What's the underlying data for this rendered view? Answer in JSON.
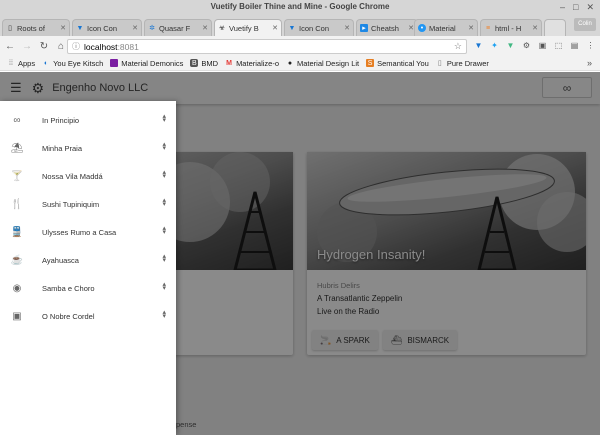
{
  "window": {
    "title": "Vuetify Boiler Thine and Mine - Google Chrome",
    "minimize": "–",
    "maximize": "□",
    "close": "✕"
  },
  "tabs": [
    {
      "label": "Roots of",
      "icon": "page-icon",
      "active": false
    },
    {
      "label": "Icon Con",
      "icon": "vuetify-icon",
      "active": false
    },
    {
      "label": "Quasar F",
      "icon": "quasar-icon",
      "active": false
    },
    {
      "label": "Vuetify B",
      "icon": "biohazard-icon",
      "active": true
    },
    {
      "label": "Icon Con",
      "icon": "vuetify-icon",
      "active": false
    },
    {
      "label": "Cheatsh",
      "icon": "cheatsheet-icon",
      "active": false
    },
    {
      "label": "Material",
      "icon": "material-icon",
      "active": false
    },
    {
      "label": "html - H",
      "icon": "stackoverflow-icon",
      "active": false
    }
  ],
  "profile_label": "Colin",
  "toolbar": {
    "url_host": "localhost",
    "url_port": ":8081"
  },
  "bookmarks": [
    {
      "label": "Apps",
      "icon": "apps-grid-icon"
    },
    {
      "label": "You Eye Kitsch",
      "icon": "vuetify-icon"
    },
    {
      "label": "Material Demonics",
      "icon": "material-icon"
    },
    {
      "label": "BMD",
      "icon": "b-icon"
    },
    {
      "label": "Materialize-o",
      "icon": "materialize-icon"
    },
    {
      "label": "Material Design Lit",
      "icon": "github-icon"
    },
    {
      "label": "Semantical You",
      "icon": "semantic-icon"
    },
    {
      "label": "Pure Drawer",
      "icon": "page-icon"
    }
  ],
  "app": {
    "title": "Engenho Novo LLC"
  },
  "card_right": {
    "media_title": "Hydrogen Insanity!",
    "subtitle": "Hubris Delirs",
    "line1": "A Transatlantic Zeppelin",
    "line2": "Live on the Radio",
    "button1": "A SPARK",
    "button2": "BISMARCK"
  },
  "footer_text": "pense",
  "drawer": {
    "items": [
      {
        "label": "In Principio",
        "icon": "infinity-icon"
      },
      {
        "label": "Minha Praia",
        "icon": "beach-icon"
      },
      {
        "label": "Nossa Vila Maddá",
        "icon": "cocktail-icon"
      },
      {
        "label": "Sushi Tupiniquim",
        "icon": "restaurant-icon"
      },
      {
        "label": "Ulysses Rumo a Casa",
        "icon": "train-icon"
      },
      {
        "label": "Ayahuasca",
        "icon": "cup-icon"
      },
      {
        "label": "Samba e Choro",
        "icon": "disc-icon"
      },
      {
        "label": "O Nobre Cordel",
        "icon": "photo-library-icon"
      }
    ]
  }
}
